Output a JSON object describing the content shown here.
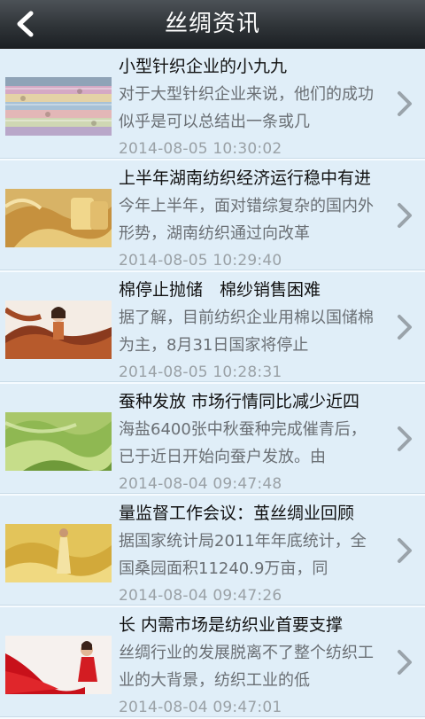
{
  "header": {
    "title": "丝绸资讯",
    "back_icon": "chevron-left-icon"
  },
  "colors": {
    "header_bg": "#2f3438",
    "item_bg": "#e0eef8",
    "title_text": "#111111",
    "summary_text": "#6a6f74",
    "date_text": "#9aa1a6"
  },
  "news": [
    {
      "title": "小型针织企业的小九九",
      "summary": "对于大型针织企业来说，他们的成功似乎是可以总结出一条或几",
      "date": "2014-08-05 10:30:02",
      "thumb": "fabric-rolls"
    },
    {
      "title": "上半年湖南纺织经济运行稳中有进",
      "summary": "今年上半年，面对错综复杂的国内外形势，湖南纺织通过向改革",
      "date": "2014-08-05 10:29:40",
      "thumb": "gold-silk"
    },
    {
      "title": "棉停止抛储　棉纱销售困难",
      "summary": "据了解，目前纺织企业用棉以国储棉为主，8月31日国家将停止",
      "date": "2014-08-05 10:28:31",
      "thumb": "woman-silk-scarf"
    },
    {
      "title": "蚕种发放 市场行情同比减少近四",
      "summary": "海盐6400张中秋蚕种完成催青后，已于近日开始向蚕户发放。由",
      "date": "2014-08-04 09:47:48",
      "thumb": "green-silk"
    },
    {
      "title": "量监督工作会议：茧丝绸业回顾",
      "summary": "据国家统计局2011年年底统计，全国桑园面积11240.9万亩，同",
      "date": "2014-08-04 09:47:26",
      "thumb": "gold-silk-model"
    },
    {
      "title": "长 内需市场是纺织业首要支撑",
      "summary": "丝绸行业的发展脱离不了整个纺织工业的大背景，纺织工业的低",
      "date": "2014-08-04 09:47:01",
      "thumb": "red-silk-model"
    }
  ]
}
